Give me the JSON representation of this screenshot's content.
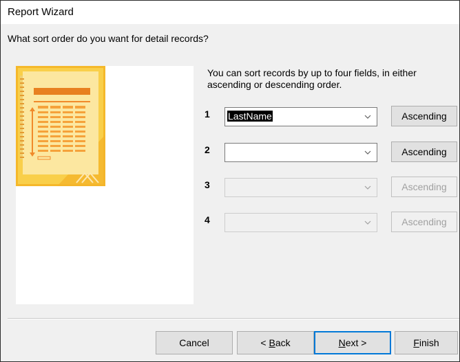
{
  "window": {
    "title": "Report Wizard"
  },
  "heading": "What sort order do you want for detail records?",
  "instructions": "You can sort records by up to four fields, in either ascending or descending order.",
  "sort_rows": [
    {
      "num": "1",
      "field": "LastName",
      "order": "Ascending",
      "enabled": true
    },
    {
      "num": "2",
      "field": "",
      "order": "Ascending",
      "enabled": true
    },
    {
      "num": "3",
      "field": "",
      "order": "Ascending",
      "enabled": false
    },
    {
      "num": "4",
      "field": "",
      "order": "Ascending",
      "enabled": false
    }
  ],
  "buttons": {
    "cancel": "Cancel",
    "back_prefix": "< ",
    "back_mnemonic": "B",
    "back_rest": "ack",
    "next_mnemonic": "N",
    "next_rest": "ext >",
    "finish_mnemonic": "F",
    "finish_rest": "inish"
  },
  "colors": {
    "preview_gold": "#f7c431",
    "preview_light": "#fbe39a",
    "preview_orange": "#e8801f",
    "default_button_border": "#0078d7"
  },
  "icons": [
    "dropdown-arrow-icon",
    "report-preview-graphic"
  ]
}
